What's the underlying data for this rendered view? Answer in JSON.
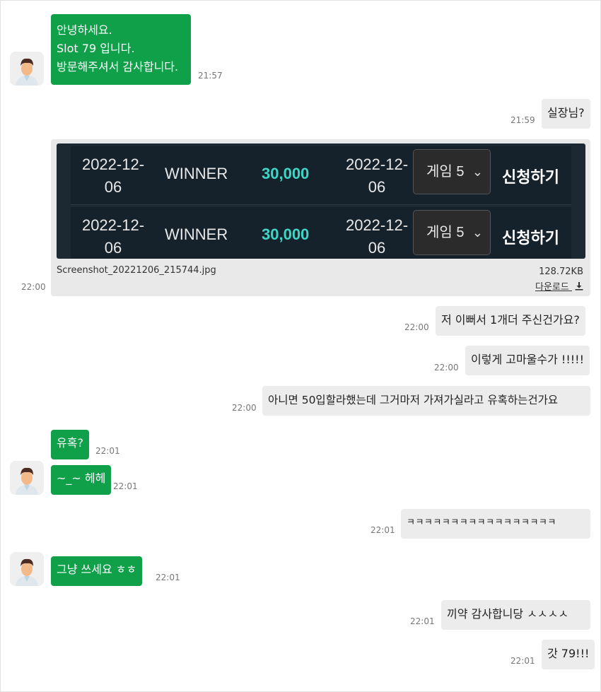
{
  "messages": {
    "m1": {
      "lines": [
        "안녕하세요.",
        "Slot 79 입니다.",
        "방문해주셔서 감사합니다."
      ],
      "time": "21:57"
    },
    "m2": {
      "text": "실장님?",
      "time": "21:59"
    },
    "m3": {
      "time": "22:00",
      "file_name": "Screenshot_20221206_215744.jpg",
      "file_size": "128.72KB",
      "download_label": "다운로드",
      "download_icon": "download-icon",
      "rows": [
        {
          "date": "2022-12-06",
          "name": "WINNER",
          "amount": "30,000",
          "date2": "2022-12-06",
          "select": "게임 5",
          "apply": "신청하기"
        },
        {
          "date": "2022-12-06",
          "name": "WINNER",
          "amount": "30,000",
          "date2": "2022-12-06",
          "select": "게임 5",
          "apply": "신청하기"
        }
      ]
    },
    "m4": {
      "text": "저 이뻐서 1개더 주신건가요?",
      "time": "22:00"
    },
    "m5": {
      "text": "이렇게 고마울수가 !!!!!",
      "time": "22:00"
    },
    "m6": {
      "text": "아니면 50입할라했는데 그거마저 가져가실라고 유혹하는건가요",
      "time": "22:00"
    },
    "m7": {
      "text": "유혹?",
      "time": "22:01"
    },
    "m8": {
      "text": "~_~ 헤헤",
      "time": "22:01"
    },
    "m9": {
      "text": "ㅋㅋㅋㅋㅋㅋㅋㅋㅋㅋㅋㅋㅋㅋㅋㅋㅋ",
      "time": "22:01"
    },
    "m10": {
      "text": "그냥 쓰세요 ㅎㅎ",
      "time": "22:01"
    },
    "m11": {
      "text": "끼약 감사합니당 ㅅㅅㅅㅅ",
      "time": "22:01"
    },
    "m12": {
      "text": "갓 79!!!",
      "time": "22:01"
    }
  },
  "colors": {
    "incoming": "#10a04a",
    "outgoing": "#ececec",
    "accent_amount": "#3fd6c8"
  }
}
